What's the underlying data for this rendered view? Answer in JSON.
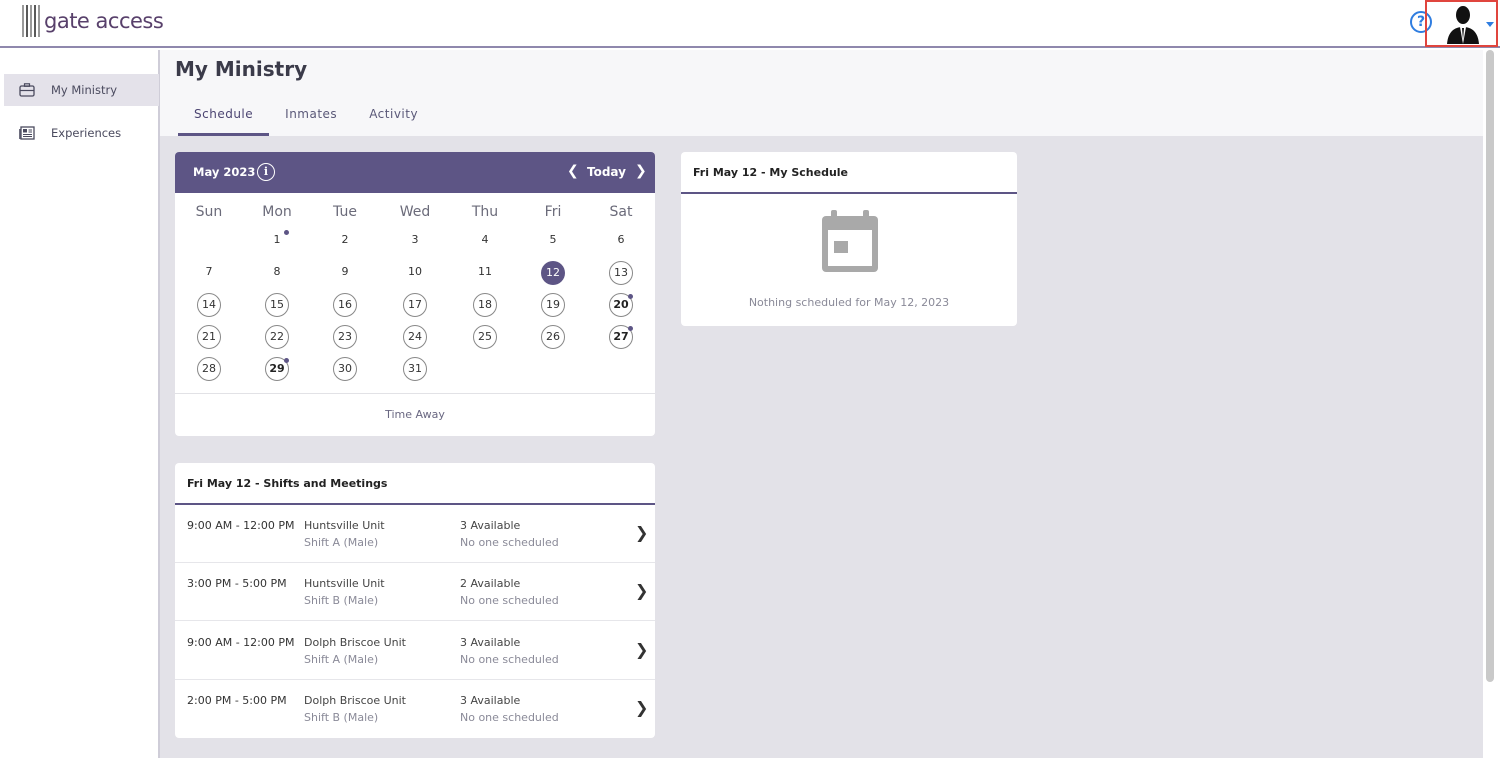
{
  "app": {
    "logo_text": "gate access",
    "help_icon": "question-circle-icon",
    "avatar_icon": "user-silhouette-icon"
  },
  "sidebar": {
    "items": [
      {
        "label": "My Ministry",
        "icon": "briefcase-icon",
        "active": true
      },
      {
        "label": "Experiences",
        "icon": "newspaper-icon",
        "active": false
      }
    ]
  },
  "page": {
    "title": "My Ministry",
    "tabs": [
      {
        "label": "Schedule",
        "active": true
      },
      {
        "label": "Inmates",
        "active": false
      },
      {
        "label": "Activity",
        "active": false
      }
    ]
  },
  "calendar": {
    "month_label": "May 2023",
    "today_label": "Today",
    "weekdays": [
      "Sun",
      "Mon",
      "Tue",
      "Wed",
      "Thu",
      "Fri",
      "Sat"
    ],
    "weeks": [
      [
        "",
        "1",
        "2",
        "3",
        "4",
        "5",
        "6"
      ],
      [
        "7",
        "8",
        "9",
        "10",
        "11",
        "12",
        "13"
      ],
      [
        "14",
        "15",
        "16",
        "17",
        "18",
        "19",
        "20"
      ],
      [
        "21",
        "22",
        "23",
        "24",
        "25",
        "26",
        "27"
      ],
      [
        "28",
        "29",
        "30",
        "31",
        "",
        "",
        ""
      ]
    ],
    "selected_day": "12",
    "circled_days": [
      "13",
      "14",
      "15",
      "16",
      "17",
      "18",
      "19",
      "20",
      "21",
      "22",
      "23",
      "24",
      "25",
      "26",
      "27",
      "28",
      "29",
      "30",
      "31"
    ],
    "bold_days": [
      "20",
      "27",
      "29"
    ],
    "dot_days": [
      "1",
      "20",
      "27",
      "29"
    ],
    "footer_label": "Time Away",
    "accent_color": "#5d5585"
  },
  "my_schedule": {
    "title": "Fri May 12 - My Schedule",
    "empty_icon": "calendar-icon",
    "empty_text": "Nothing scheduled for May 12, 2023"
  },
  "shifts": {
    "title": "Fri May 12 - Shifts and Meetings",
    "rows": [
      {
        "time": "9:00 AM - 12:00 PM",
        "unit": "Huntsville Unit",
        "shift": "Shift A (Male)",
        "available": "3 Available",
        "status": "No one scheduled"
      },
      {
        "time": "3:00 PM - 5:00 PM",
        "unit": "Huntsville Unit",
        "shift": "Shift B (Male)",
        "available": "2 Available",
        "status": "No one scheduled"
      },
      {
        "time": "9:00 AM - 12:00 PM",
        "unit": "Dolph Briscoe Unit",
        "shift": "Shift A (Male)",
        "available": "3 Available",
        "status": "No one scheduled"
      },
      {
        "time": "2:00 PM - 5:00 PM",
        "unit": "Dolph Briscoe Unit",
        "shift": "Shift B (Male)",
        "available": "3 Available",
        "status": "No one scheduled"
      }
    ]
  }
}
